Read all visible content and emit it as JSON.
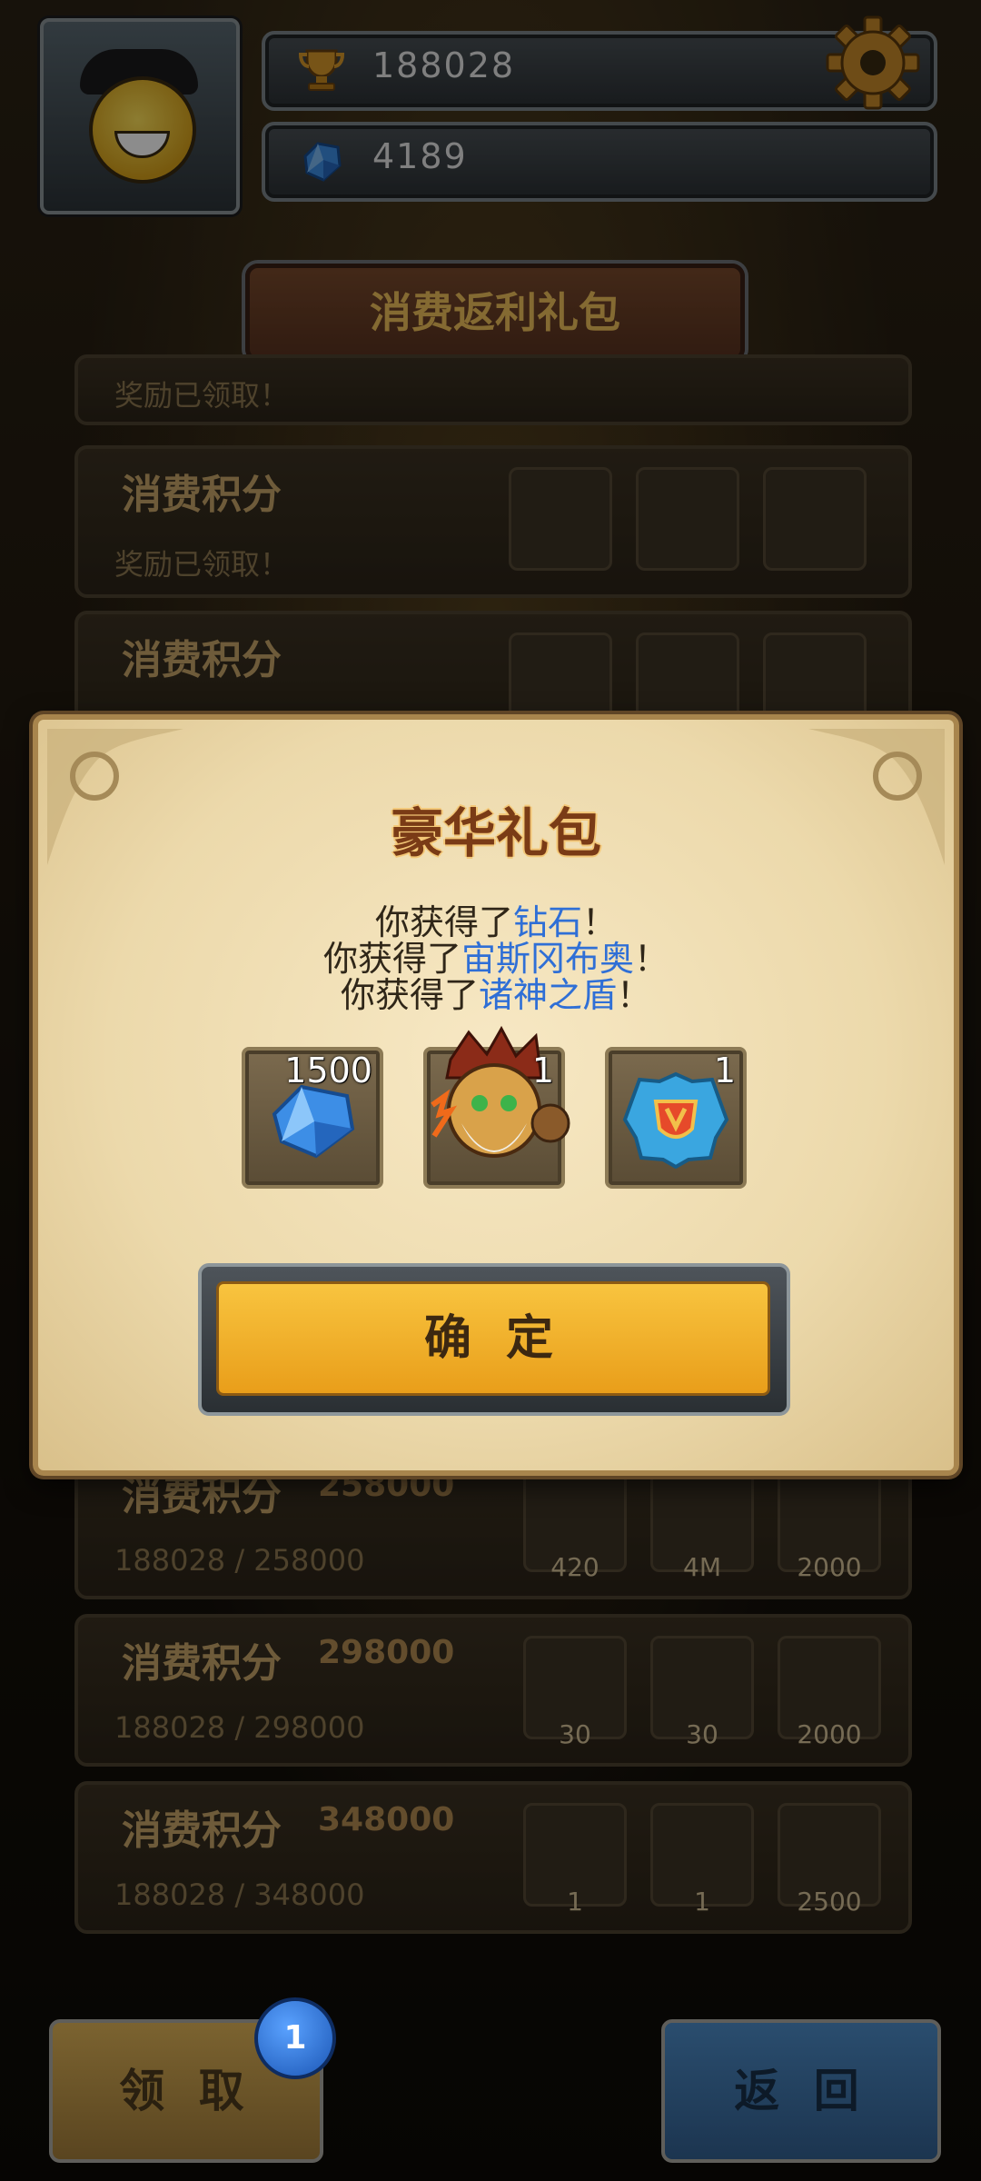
{
  "hud": {
    "trophy_value": "188028",
    "gem_value": "4189"
  },
  "page_title": "消费返利礼包",
  "rows": [
    {
      "title": "消费积分",
      "points": "",
      "sub": "奖励已领取！"
    },
    {
      "title": "消费积分",
      "points": "",
      "sub": "奖励已领取！"
    },
    {
      "title": "消费积分",
      "points": "",
      "sub": ""
    },
    {
      "title": "消费积分",
      "points": "258000",
      "sub": "188028 / 258000",
      "counts": [
        "420",
        "4M",
        "2000"
      ]
    },
    {
      "title": "消费积分",
      "points": "298000",
      "sub": "188028 / 298000",
      "counts": [
        "30",
        "30",
        "2000"
      ]
    },
    {
      "title": "消费积分",
      "points": "348000",
      "sub": "188028 / 348000",
      "counts": [
        "1",
        "1",
        "2500"
      ]
    }
  ],
  "modal": {
    "title": "豪华礼包",
    "lines": [
      {
        "prefix": "你获得了",
        "item": "钻石",
        "suffix": "！"
      },
      {
        "prefix": "你获得了",
        "item": "宙斯冈布奥",
        "suffix": "！"
      },
      {
        "prefix": "你获得了",
        "item": "诸神之盾",
        "suffix": "！"
      }
    ],
    "rewards": [
      {
        "icon": "diamond-icon",
        "count": "1500"
      },
      {
        "icon": "zeus-hero-icon",
        "count": "1"
      },
      {
        "icon": "shield-of-gods-icon",
        "count": "1"
      }
    ],
    "confirm_label": "确 定"
  },
  "bottom": {
    "claim_label": "领 取",
    "claim_badge": "1",
    "back_label": "返 回"
  },
  "colors": {
    "highlight_text": "#2f6fd6",
    "confirm_button": "#f0b030",
    "back_button": "#1f3c5a"
  }
}
